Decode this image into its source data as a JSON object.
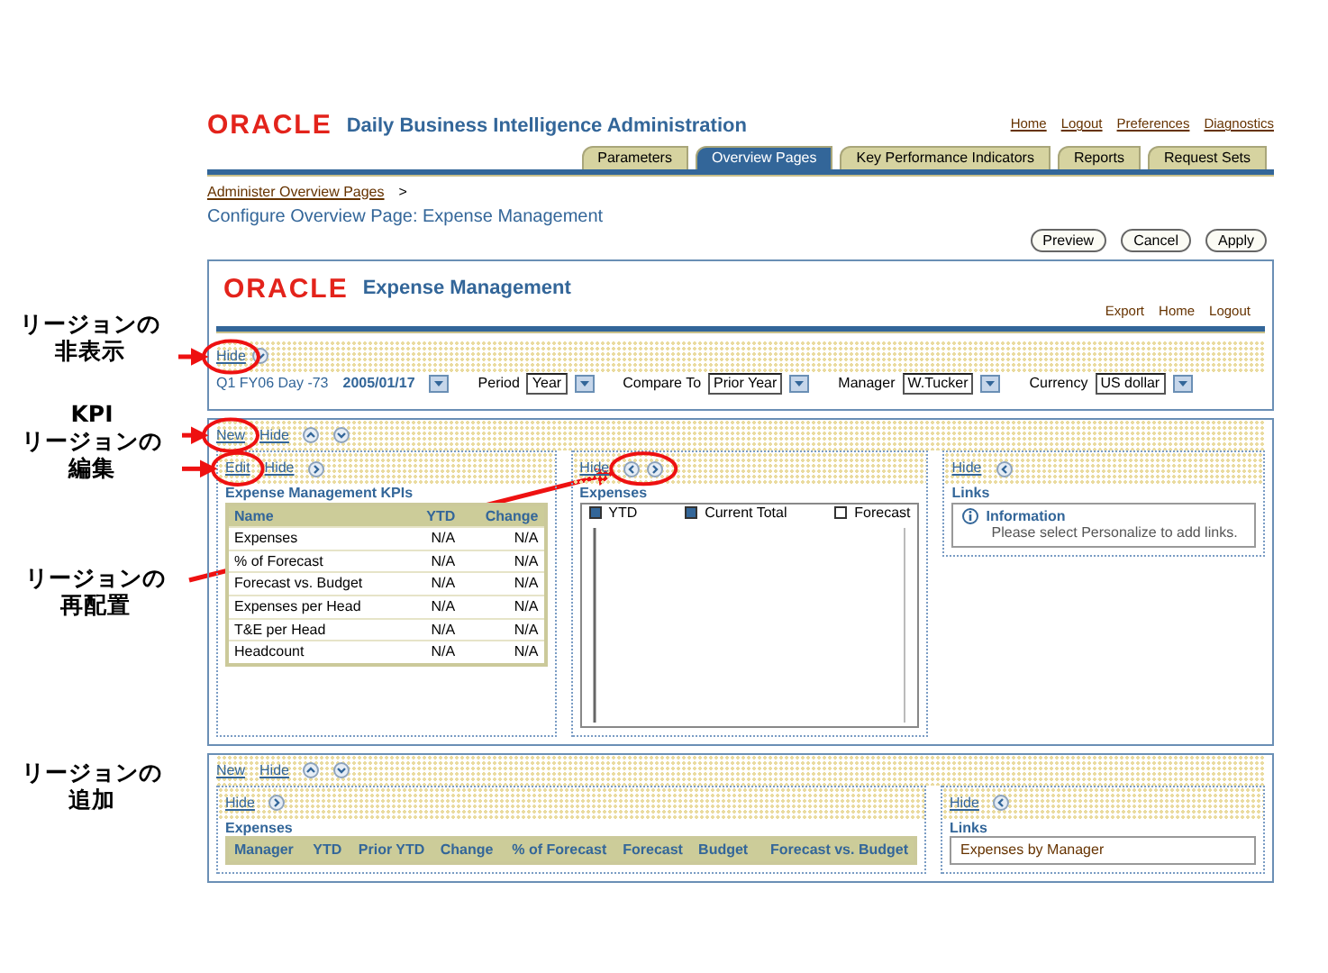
{
  "callouts": [
    {
      "lines": [
        "リージョンの",
        "非表示"
      ]
    },
    {
      "lines": [
        "KPI",
        "リージョンの",
        "編集"
      ]
    },
    {
      "lines": [
        "リージョンの",
        "再配置"
      ]
    },
    {
      "lines": [
        "リージョンの",
        "追加"
      ]
    }
  ],
  "app": {
    "logo": "ORACLE",
    "title": "Daily Business Intelligence Administration",
    "global_links": [
      "Home",
      "Logout",
      "Preferences",
      "Diagnostics"
    ],
    "tabs": [
      {
        "label": "Parameters",
        "selected": false
      },
      {
        "label": "Overview Pages",
        "selected": true
      },
      {
        "label": "Key Performance Indicators",
        "selected": false
      },
      {
        "label": "Reports",
        "selected": false
      },
      {
        "label": "Request Sets",
        "selected": false
      }
    ],
    "breadcrumb": "Administer Overview Pages",
    "breadcrumb_separator": ">",
    "page_title": "Configure Overview Page: Expense Management",
    "buttons": [
      "Preview",
      "Cancel",
      "Apply"
    ]
  },
  "preview": {
    "logo": "ORACLE",
    "title": "Expense Management",
    "links": [
      "Export",
      "Home",
      "Logout"
    ],
    "parameters_region": {
      "hide": "Hide",
      "icons": [
        {
          "kind": "down"
        }
      ],
      "as_of": "Q1 FY06 Day -73",
      "date": "2005/01/17",
      "fields": [
        {
          "label": "Period",
          "value": "Year"
        },
        {
          "label": "Compare To",
          "value": "Prior Year"
        },
        {
          "label": "Manager",
          "value": "W.Tucker"
        },
        {
          "label": "Currency",
          "value": "US dollar"
        }
      ]
    },
    "sections": [
      {
        "new": "New",
        "hide": "Hide",
        "icons": [
          {
            "kind": "up"
          },
          {
            "kind": "down"
          }
        ],
        "regions": [
          {
            "kind": "kpi_table",
            "actions": [
              "Edit",
              "Hide"
            ],
            "icons": [
              {
                "kind": "right"
              }
            ],
            "title": "Expense Management KPIs",
            "columns": [
              "Name",
              "YTD",
              "Change"
            ],
            "rows": [
              [
                "Expenses",
                "N/A",
                "N/A"
              ],
              [
                "% of Forecast",
                "N/A",
                "N/A"
              ],
              [
                "Forecast vs. Budget",
                "N/A",
                "N/A"
              ],
              [
                "Expenses per Head",
                "N/A",
                "N/A"
              ],
              [
                "T&E per Head",
                "N/A",
                "N/A"
              ],
              [
                "Headcount",
                "N/A",
                "N/A"
              ]
            ]
          },
          {
            "kind": "chart",
            "actions": [
              "Hide"
            ],
            "icons": [
              {
                "kind": "left"
              },
              {
                "kind": "right"
              }
            ],
            "title": "Expenses",
            "legend": [
              {
                "label": "YTD",
                "filled": true
              },
              {
                "label": "Current Total",
                "filled": true
              },
              {
                "label": "Forecast",
                "filled": false
              }
            ]
          },
          {
            "kind": "links",
            "actions": [
              "Hide"
            ],
            "icons": [
              {
                "kind": "left"
              }
            ],
            "title": "Links",
            "info_title": "Information",
            "info_text": "Please select Personalize to add links."
          }
        ]
      },
      {
        "new": "New",
        "hide": "Hide",
        "icons": [
          {
            "kind": "up"
          },
          {
            "kind": "down"
          }
        ],
        "regions": [
          {
            "kind": "table",
            "actions": [
              "Hide"
            ],
            "icons": [
              {
                "kind": "right"
              }
            ],
            "title": "Expenses",
            "columns": [
              "Manager",
              "YTD",
              "Prior YTD",
              "Change",
              "% of Forecast",
              "Forecast",
              "Budget",
              "Forecast vs. Budget"
            ]
          },
          {
            "kind": "links",
            "actions": [
              "Hide"
            ],
            "icons": [
              {
                "kind": "left"
              }
            ],
            "title": "Links",
            "items": [
              "Expenses by Manager"
            ]
          }
        ]
      }
    ]
  }
}
